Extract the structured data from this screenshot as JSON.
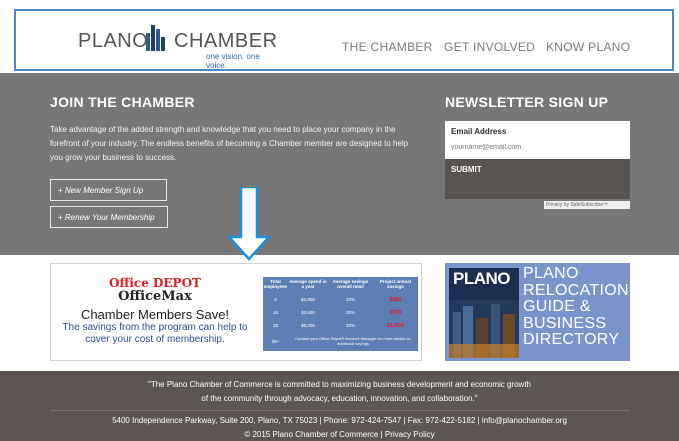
{
  "header": {
    "logo": {
      "left": "PLANO",
      "right": "CHAMBER",
      "tagline": "one vision. one voice."
    },
    "nav": [
      "THE CHAMBER",
      "GET INVOLVED",
      "KNOW PLANO"
    ]
  },
  "join": {
    "title": "JOIN THE CHAMBER",
    "text": "Take advantage of the added strength and knowledge that you need to place your company in the forefront of your industry. The endless benefits of becoming a Chamber member are designed to help you grow your business to success.",
    "buttons": [
      "+ New Member Sign Up",
      "+ Renew Your Membership"
    ]
  },
  "newsletter": {
    "title": "NEWSLETTER SIGN UP",
    "email_label": "Email Address",
    "email_placeholder": "yourname@email.com",
    "submit": "SUBMIT",
    "privacy": "Privacy by SafeSubscribe™"
  },
  "office_ad": {
    "brand1": "Office DEPOT",
    "brand2": "OfficeMax",
    "headline": "Chamber Members Save!",
    "subtext": "The savings from the program can help to cover your cost of membership.",
    "table": {
      "headers": [
        "Total employees",
        "Average spend in a year",
        "Average savings overall retail",
        "Project annual savings"
      ],
      "rows": [
        [
          "5",
          "$1,800",
          "20%",
          "$360"
        ],
        [
          "10",
          "$3,600",
          "20%",
          "$720"
        ],
        [
          "25",
          "$9,000",
          "20%",
          "$1,800"
        ]
      ],
      "last_row_label": "26+",
      "note": "Contact your Office Depot® Account Manager for more details on additional savings"
    }
  },
  "plano_ad": {
    "mag_title": "PLANO",
    "lines": [
      "PLANO",
      "RELOCATION",
      "GUIDE &",
      "BUSINESS",
      "DIRECTORY"
    ]
  },
  "footer": {
    "quote_line1": "\"The Plano Chamber of Commerce is committed to maximizing business development and economic growth",
    "quote_line2": "of the community through advocacy, education, innovation, and collaboration.\"",
    "contact": "5400 Independence Parkway, Suite 200, Plano, TX 75023  |  Phone: 972-424-7547  |  Fax: 972-422-5182  |  info@planochamber.org",
    "copyright": "© 2015 Plano Chamber of Commerce",
    "privacy_link": "Privacy Policy"
  },
  "colors": {
    "accent": "#4a86c8",
    "gray": "#777777",
    "footer": "#5c5552",
    "ad_blue": "#7c94cc"
  },
  "icons": [
    "down-arrow-icon"
  ]
}
